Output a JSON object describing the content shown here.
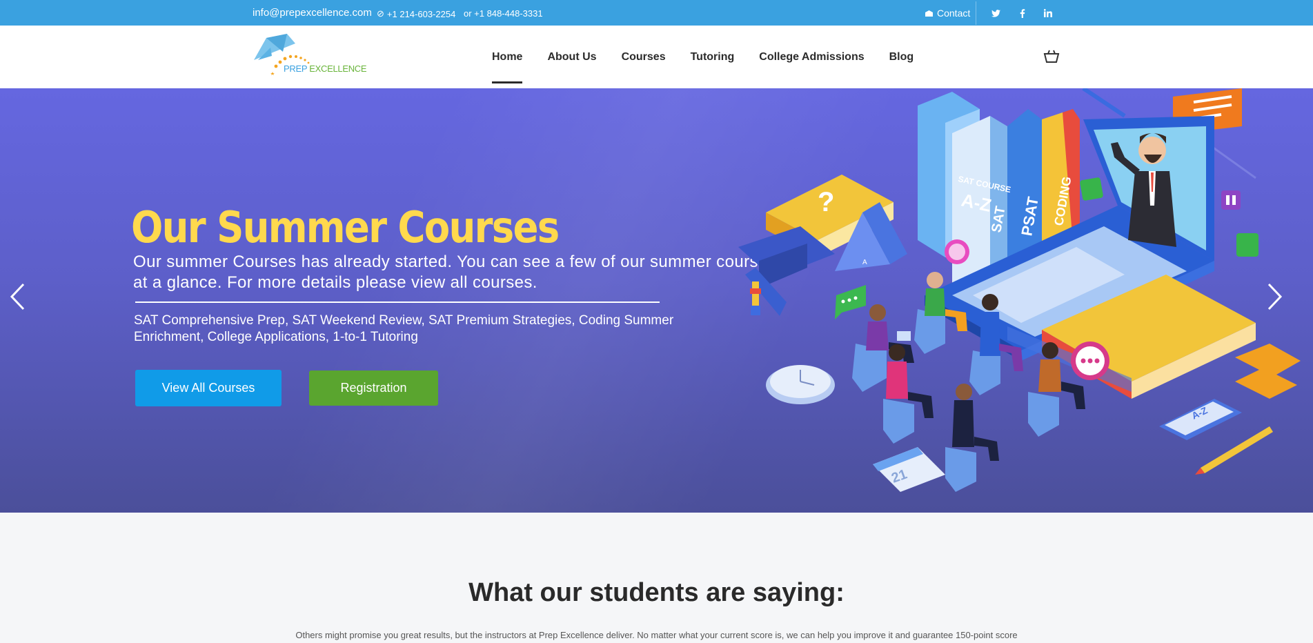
{
  "topbar": {
    "email": "info@prepexcellence.com",
    "phone1": "+1 214-603-2254",
    "phone2": "or +1 848-448-3331",
    "contact": "Contact",
    "social_icons": [
      "twitter-icon",
      "facebook-icon",
      "linkedin-icon"
    ]
  },
  "header": {
    "logo_text_1": "PREP",
    "logo_text_2": " EXCELLENCE",
    "nav": [
      "Home",
      "About Us",
      "Courses",
      "Tutoring",
      "College Admissions",
      "Blog"
    ],
    "active_nav": "Home"
  },
  "hero": {
    "title": "Our Summer Courses",
    "subtitle": "Our summer Courses has already started. You can see a few of our summer courses at a glance. For more details please view all courses.",
    "courses_list": "SAT Comprehensive Prep, SAT Weekend Review, SAT Premium Strategies, Coding Summer Enrichment, College Applications, 1-to-1 Tutoring",
    "btn_courses": "View All Courses",
    "btn_registration": "Registration",
    "illustration_labels": [
      "SAT COURSE",
      "A-Z",
      "SAT",
      "PSAT",
      "CODING",
      "21",
      "A-Z",
      "A"
    ]
  },
  "testimonials": {
    "title": "What our students are saying:",
    "text": "Others might promise you great results, but the instructors at Prep Excellence deliver. No matter what your current score is, we can help you improve it and guarantee 150-point score"
  },
  "colors": {
    "topbar": "#3aa1e0",
    "hero_title": "#ffd94d",
    "btn_courses": "#109be8",
    "btn_registration": "#5aa52f"
  }
}
